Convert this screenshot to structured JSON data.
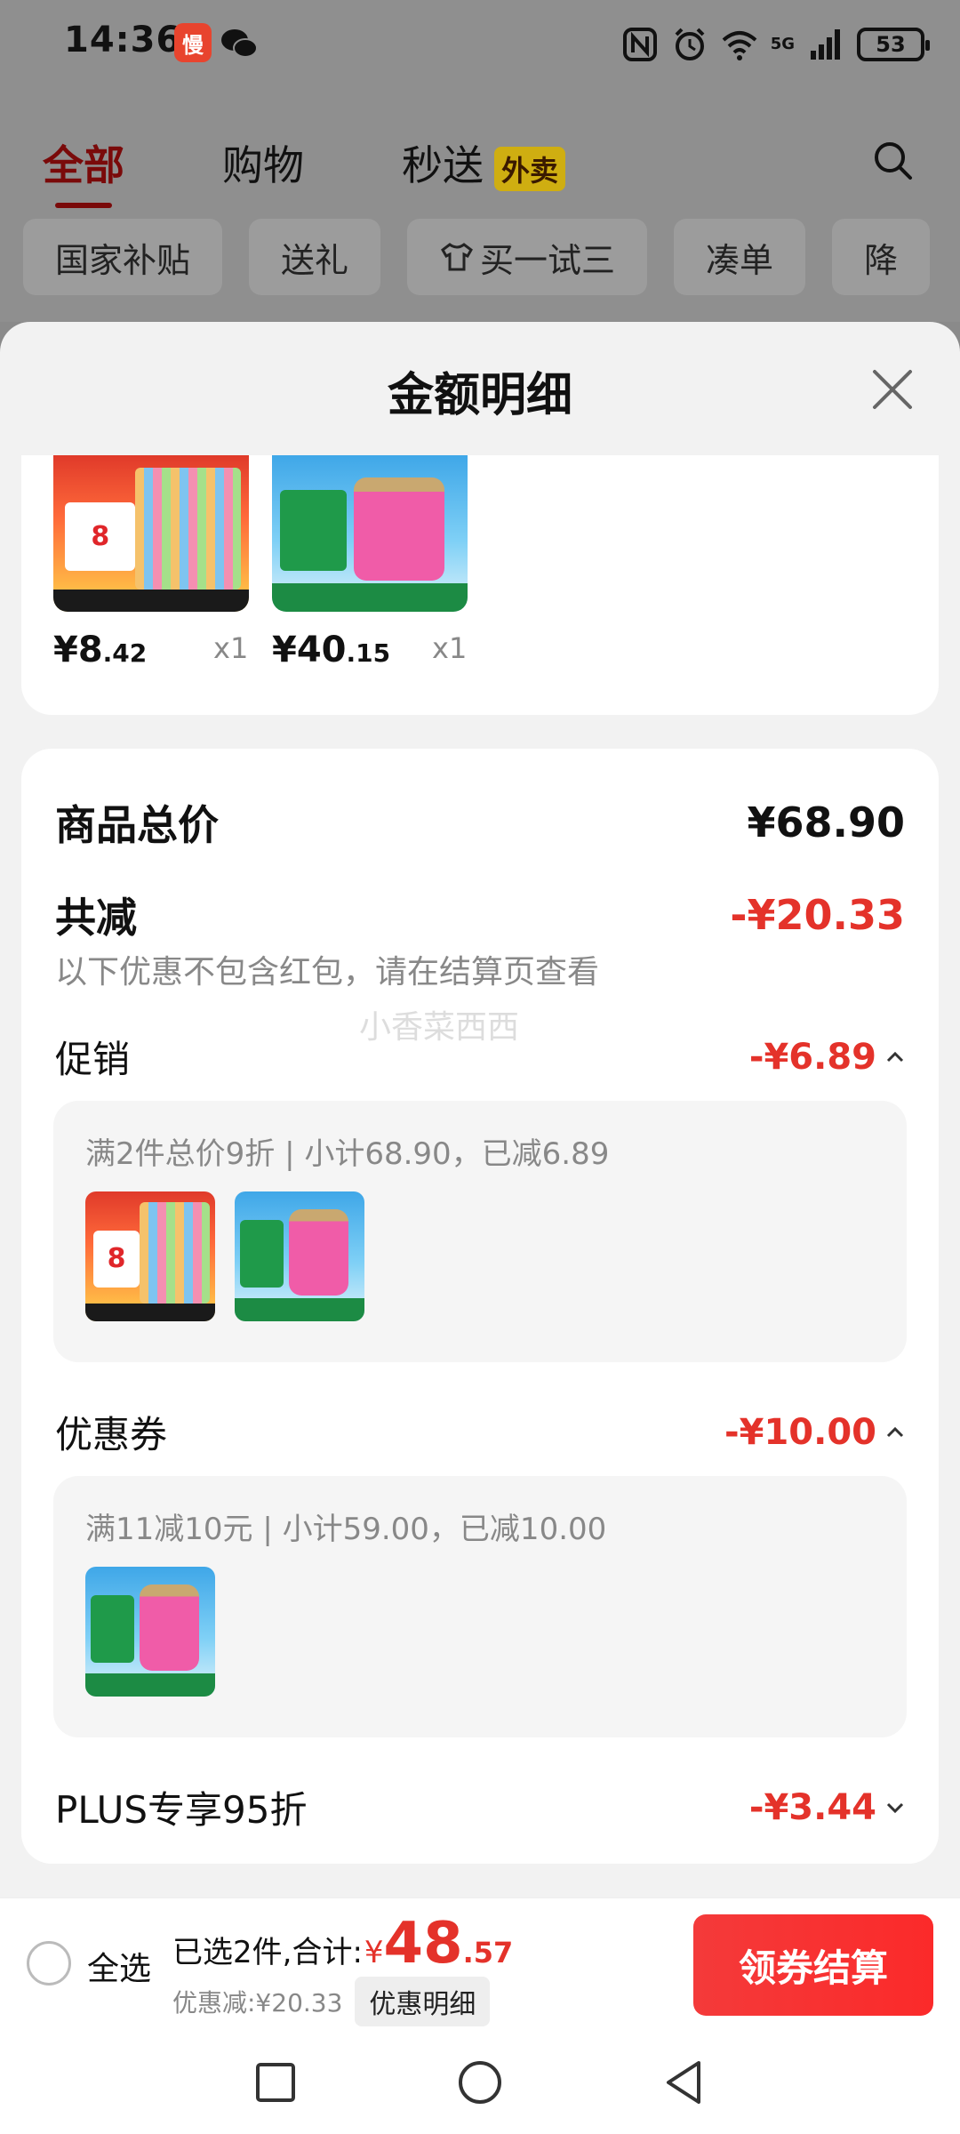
{
  "status_bar": {
    "time": "14:36",
    "app_badge": "慢",
    "network": "5G",
    "battery": "53"
  },
  "header": {
    "tabs": [
      {
        "label": "全部"
      },
      {
        "label": "购物"
      },
      {
        "label": "秒送",
        "badge": "外卖"
      }
    ],
    "chips": [
      "国家补贴",
      "送礼",
      "买一试三",
      "凑单",
      "降"
    ]
  },
  "sheet": {
    "title": "金额明细",
    "products": [
      {
        "price_int": "¥8",
        "price_dec": ".42",
        "qty": "x1"
      },
      {
        "price_int": "¥40",
        "price_dec": ".15",
        "qty": "x1"
      }
    ],
    "total_label": "商品总价",
    "total_value": "¥68.90",
    "reduce_label": "共减",
    "reduce_value": "-¥20.33",
    "reduce_note": "以下优惠不包含红包，请在结算页查看",
    "watermark": "小香菜西西",
    "promo_label": "促销",
    "promo_value": "-¥6.89",
    "promo_detail": "满2件总价9折 | 小计68.90，已减6.89",
    "coupon_label": "优惠券",
    "coupon_value": "-¥10.00",
    "coupon_detail": "满11减10元 | 小计59.00，已减10.00",
    "plus_label": "PLUS专享95折",
    "plus_value": "-¥3.44"
  },
  "bottom_bar": {
    "select_all": "全选",
    "selected_text": "已选2件,合计:",
    "currency": "¥",
    "total_int": "48",
    "total_dec": ".57",
    "discount_text": "优惠减:¥20.33",
    "detail_button": "优惠明细",
    "checkout_button": "领券结算"
  },
  "colors": {
    "accent_red": "#e4322a",
    "checkout_red": "#f43a3a"
  },
  "icons": [
    "wechat-icon",
    "nfc-icon",
    "alarm-icon",
    "wifi-icon",
    "signal-icon",
    "search-icon",
    "close-icon",
    "chevron-up-icon",
    "chevron-down-icon",
    "recent-apps-icon",
    "home-icon",
    "back-icon"
  ]
}
